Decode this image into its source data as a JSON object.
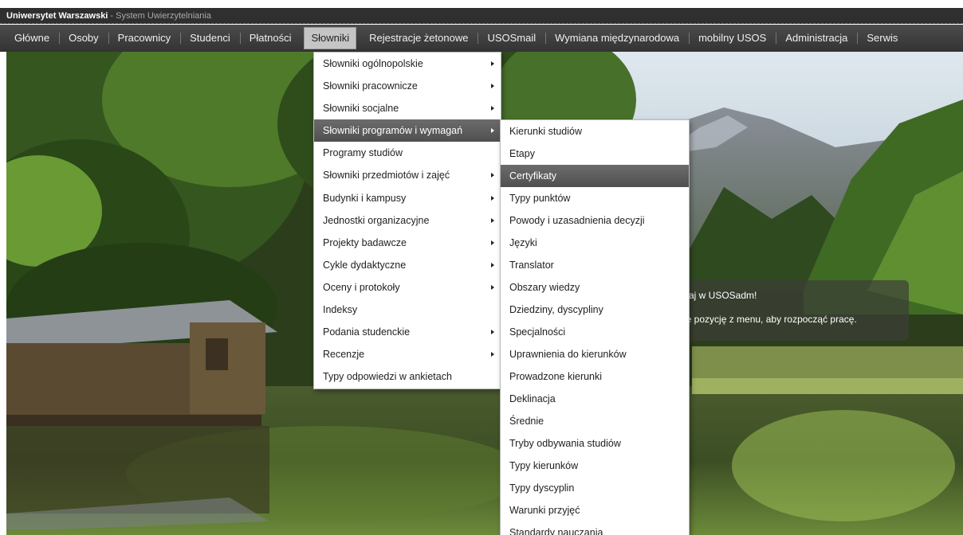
{
  "titlebar": {
    "university": "Uniwersytet Warszawski",
    "separator": " - ",
    "system": "System Uwierzytelniania"
  },
  "nav": {
    "items": [
      {
        "label": "Główne"
      },
      {
        "label": "Osoby"
      },
      {
        "label": "Pracownicy"
      },
      {
        "label": "Studenci"
      },
      {
        "label": "Płatności"
      },
      {
        "label": "Słowniki"
      },
      {
        "label": "Rejestracje żetonowe"
      },
      {
        "label": "USOSmail"
      },
      {
        "label": "Wymiana międzynarodowa"
      },
      {
        "label": "mobilny USOS"
      },
      {
        "label": "Administracja"
      },
      {
        "label": "Serwis"
      }
    ],
    "active_index": 5
  },
  "menu1": {
    "items": [
      {
        "label": "Słowniki ogólnopolskie",
        "submenu": true
      },
      {
        "label": "Słowniki pracownicze",
        "submenu": true
      },
      {
        "label": "Słowniki socjalne",
        "submenu": true
      },
      {
        "label": "Słowniki programów i wymagań",
        "submenu": true
      },
      {
        "label": "Programy studiów",
        "submenu": false
      },
      {
        "label": "Słowniki przedmiotów i zajęć",
        "submenu": true
      },
      {
        "label": "Budynki i kampusy",
        "submenu": true
      },
      {
        "label": "Jednostki organizacyjne",
        "submenu": true
      },
      {
        "label": "Projekty badawcze",
        "submenu": true
      },
      {
        "label": "Cykle dydaktyczne",
        "submenu": true
      },
      {
        "label": "Oceny i protokoły",
        "submenu": true
      },
      {
        "label": "Indeksy",
        "submenu": false
      },
      {
        "label": "Podania studenckie",
        "submenu": true
      },
      {
        "label": "Recenzje",
        "submenu": true
      },
      {
        "label": "Typy odpowiedzi w ankietach",
        "submenu": false
      }
    ],
    "highlighted_index": 3
  },
  "menu2": {
    "items": [
      {
        "label": "Kierunki studiów"
      },
      {
        "label": "Etapy"
      },
      {
        "label": "Certyfikaty"
      },
      {
        "label": "Typy punktów"
      },
      {
        "label": "Powody i uzasadnienia decyzji"
      },
      {
        "label": "Języki"
      },
      {
        "label": "Translator"
      },
      {
        "label": "Obszary wiedzy"
      },
      {
        "label": "Dziedziny, dyscypliny"
      },
      {
        "label": "Specjalności"
      },
      {
        "label": "Uprawnienia do kierunków"
      },
      {
        "label": "Prowadzone kierunki"
      },
      {
        "label": "Deklinacja"
      },
      {
        "label": "Średnie"
      },
      {
        "label": "Tryby odbywania studiów"
      },
      {
        "label": "Typy kierunków"
      },
      {
        "label": "Typy dyscyplin"
      },
      {
        "label": "Warunki przyjęć"
      },
      {
        "label": "Standardy nauczania"
      }
    ],
    "highlighted_index": 2
  },
  "welcome": {
    "line1": "itaj w USOSadm!",
    "line2": "ię pozycję z menu, aby rozpocząć pracę."
  },
  "icons": {
    "submenu_arrow": "caret-right-icon"
  }
}
